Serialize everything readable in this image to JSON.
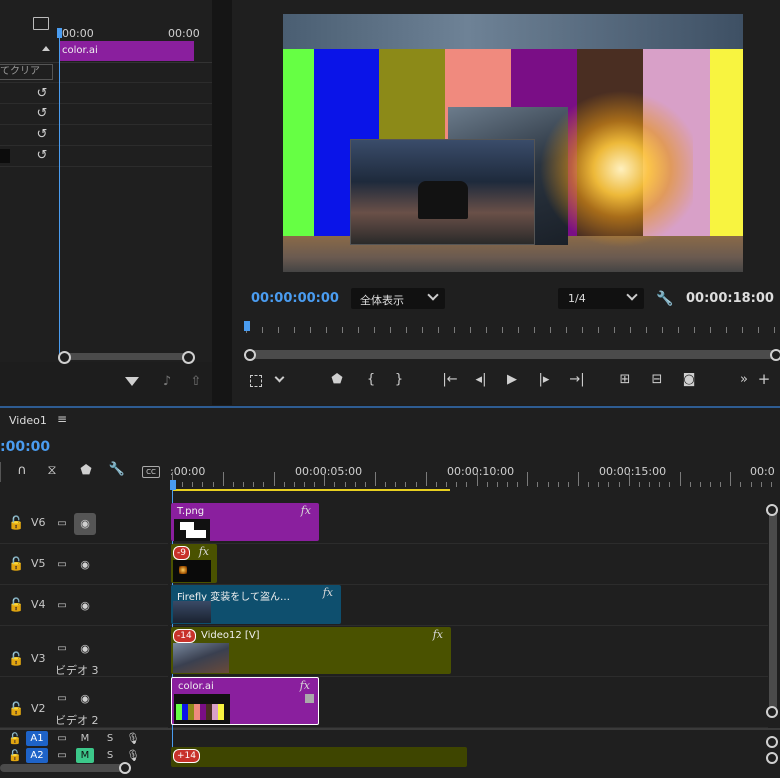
{
  "source_panel": {
    "ruler_start": "00:00",
    "ruler_end": "00:00",
    "clip_name": "color.ai",
    "clear_label": "てクリア"
  },
  "program": {
    "timecode_current": "00:00:00:00",
    "zoom_select": "全体表示",
    "quality_select": "1/4",
    "timecode_duration": "00:00:18:00"
  },
  "timeline": {
    "sequence_tab": "Video1",
    "timecode": ":00:00",
    "ruler_labels": [
      ":00:00",
      "00:00:05:00",
      "00:00:10:00",
      "00:00:15:00",
      "00:0"
    ],
    "tracks": [
      {
        "name": "V6",
        "sub": ""
      },
      {
        "name": "V5",
        "sub": ""
      },
      {
        "name": "V4",
        "sub": ""
      },
      {
        "name": "V3",
        "sub": "ビデオ 3"
      },
      {
        "name": "V2",
        "sub": "ビデオ 2"
      }
    ],
    "audio": [
      {
        "name": "A1",
        "m": "M",
        "s": "S"
      },
      {
        "name": "A2",
        "m": "M",
        "s": "S"
      }
    ],
    "clips": {
      "v6": {
        "label": "T.png",
        "fx": "fx"
      },
      "v5": {
        "badge": "-9",
        "fx": "fx"
      },
      "v4": {
        "label": "Firefly 変装をして盗ん…",
        "fx": "fx"
      },
      "v3": {
        "badge": "-14",
        "label": "Video12 [V]",
        "fx": "fx"
      },
      "v2": {
        "label": "color.ai",
        "fx": "fx"
      },
      "a2": {
        "badge": "+14"
      }
    }
  },
  "colors": {
    "accent_blue": "#4a9cf0",
    "clip_purple": "#8a1f9e",
    "clip_olive": "#4a5200",
    "clip_teal": "#0e4f6e"
  }
}
